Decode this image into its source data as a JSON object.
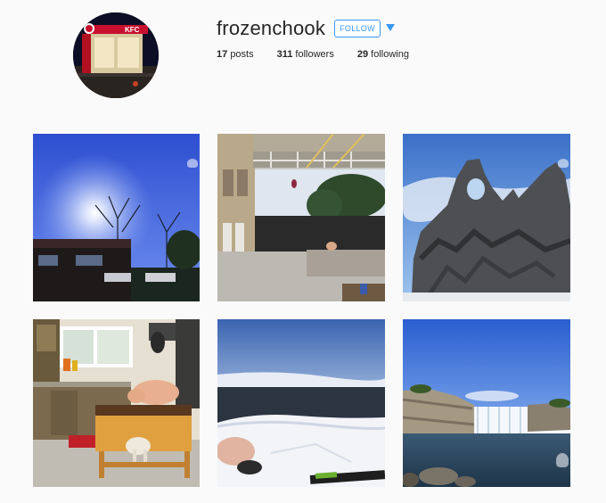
{
  "profile": {
    "username": "frozenchook",
    "follow_label": "FOLLOW",
    "avatar_sign": "KFC",
    "stats": {
      "posts_count": "17",
      "posts_label": "posts",
      "followers_count": "311",
      "followers_label": "followers",
      "following_count": "29",
      "following_label": "following"
    }
  },
  "colors": {
    "accent": "#3897f0",
    "background": "#fafafa"
  },
  "icons": {
    "dropdown": "chevron-down-icon",
    "watermark": "watermark-icon"
  },
  "posts": [
    {
      "scene": "suburban-sunburst-sky"
    },
    {
      "scene": "courtyard-balcony-figure"
    },
    {
      "scene": "volcanic-rock-arch"
    },
    {
      "scene": "kitchen-figure-table-dog"
    },
    {
      "scene": "snowy-hill-figure"
    },
    {
      "scene": "river-waterfall"
    }
  ]
}
